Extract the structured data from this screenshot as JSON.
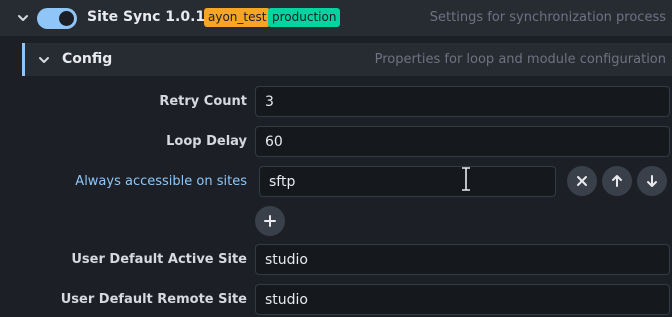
{
  "header": {
    "title": "Site Sync 1.0.1",
    "badges": [
      "ayon_test",
      "production"
    ],
    "description": "Settings for synchronization process",
    "enabled": true
  },
  "config": {
    "title": "Config",
    "description": "Properties for loop and module configuration"
  },
  "fields": {
    "retry_count": {
      "label": "Retry Count",
      "value": "3"
    },
    "loop_delay": {
      "label": "Loop Delay",
      "value": "60"
    },
    "always_accessible": {
      "label": "Always accessible on sites",
      "items": [
        "sftp"
      ]
    },
    "default_active": {
      "label": "User Default Active Site",
      "value": "studio"
    },
    "default_remote": {
      "label": "User Default Remote Site",
      "value": "studio"
    }
  },
  "icons": {
    "collapse": "chevron-down-icon",
    "remove": "close-icon",
    "move_up": "arrow-up-icon",
    "move_down": "arrow-down-icon",
    "add": "plus-icon",
    "cursor": "text-cursor-icon"
  },
  "colors": {
    "accent": "#8fc6f7",
    "badge_project": "#f5a623",
    "badge_production": "#00d49f"
  }
}
